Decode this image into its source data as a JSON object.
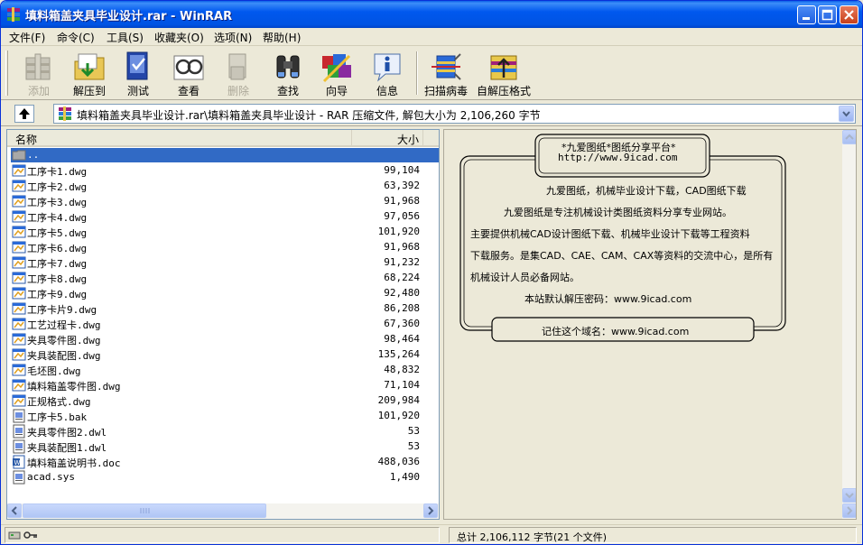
{
  "window": {
    "title": "填料箱盖夹具毕业设计.rar - WinRAR"
  },
  "menu": [
    "文件(F)",
    "命令(C)",
    "工具(S)",
    "收藏夹(O)",
    "选项(N)",
    "帮助(H)"
  ],
  "toolbar": {
    "buttons": [
      {
        "label": "添加",
        "icon": "add-archive-icon",
        "enabled": false
      },
      {
        "label": "解压到",
        "icon": "extract-to-icon",
        "enabled": true
      },
      {
        "label": "测试",
        "icon": "test-icon",
        "enabled": true
      },
      {
        "label": "查看",
        "icon": "view-icon",
        "enabled": true
      },
      {
        "label": "删除",
        "icon": "delete-icon",
        "enabled": false
      },
      {
        "label": "查找",
        "icon": "find-icon",
        "enabled": true
      },
      {
        "label": "向导",
        "icon": "wizard-icon",
        "enabled": true
      },
      {
        "label": "信息",
        "icon": "info-icon",
        "enabled": true
      },
      {
        "label": "扫描病毒",
        "icon": "virus-scan-icon",
        "enabled": true
      },
      {
        "label": "自解压格式",
        "icon": "sfx-icon",
        "enabled": true
      }
    ]
  },
  "address": {
    "path": "填料箱盖夹具毕业设计.rar\\填料箱盖夹具毕业设计 - RAR 压缩文件, 解包大小为 2,106,260 字节"
  },
  "filelist": {
    "columns": {
      "name": "名称",
      "size": "大小"
    },
    "parent": "..",
    "files": [
      {
        "name": "工序卡1.dwg",
        "size": "99,104",
        "type": "dwg"
      },
      {
        "name": "工序卡2.dwg",
        "size": "63,392",
        "type": "dwg"
      },
      {
        "name": "工序卡3.dwg",
        "size": "91,968",
        "type": "dwg"
      },
      {
        "name": "工序卡4.dwg",
        "size": "97,056",
        "type": "dwg"
      },
      {
        "name": "工序卡5.dwg",
        "size": "101,920",
        "type": "dwg"
      },
      {
        "name": "工序卡6.dwg",
        "size": "91,968",
        "type": "dwg"
      },
      {
        "name": "工序卡7.dwg",
        "size": "91,232",
        "type": "dwg"
      },
      {
        "name": "工序卡8.dwg",
        "size": "68,224",
        "type": "dwg"
      },
      {
        "name": "工序卡9.dwg",
        "size": "92,480",
        "type": "dwg"
      },
      {
        "name": "工序卡片9.dwg",
        "size": "86,208",
        "type": "dwg"
      },
      {
        "name": "工艺过程卡.dwg",
        "size": "67,360",
        "type": "dwg"
      },
      {
        "name": "夹具零件图.dwg",
        "size": "98,464",
        "type": "dwg"
      },
      {
        "name": "夹具装配图.dwg",
        "size": "135,264",
        "type": "dwg"
      },
      {
        "name": "毛坯图.dwg",
        "size": "48,832",
        "type": "dwg"
      },
      {
        "name": "填料箱盖零件图.dwg",
        "size": "71,104",
        "type": "dwg"
      },
      {
        "name": "正规格式.dwg",
        "size": "209,984",
        "type": "dwg"
      },
      {
        "name": "工序卡5.bak",
        "size": "101,920",
        "type": "sys"
      },
      {
        "name": "夹具零件图2.dwl",
        "size": "53",
        "type": "sys"
      },
      {
        "name": "夹具装配图1.dwl",
        "size": "53",
        "type": "sys"
      },
      {
        "name": "填料箱盖说明书.doc",
        "size": "488,036",
        "type": "doc"
      },
      {
        "name": "acad.sys",
        "size": "1,490",
        "type": "sys"
      }
    ]
  },
  "comment": {
    "banner_title": "*九爱图纸*图纸分享平台*",
    "banner_url": "http://www.9icad.com",
    "lines": [
      "九爱图纸，机械毕业设计下载，CAD图纸下载",
      "九爱图纸是专注机械设计类图纸资料分享专业网站。",
      "主要提供机械CAD设计图纸下载、机械毕业设计下载等工程资料",
      "下载服务。是集CAD、CAE、CAM、CAX等资料的交流中心，是所有",
      "机械设计人员必备网站。",
      "本站默认解压密码：www.9icad.com"
    ],
    "footer": "记住这个域名：www.9icad.com"
  },
  "status": {
    "total": "总计 2,106,112 字节(21 个文件)"
  }
}
